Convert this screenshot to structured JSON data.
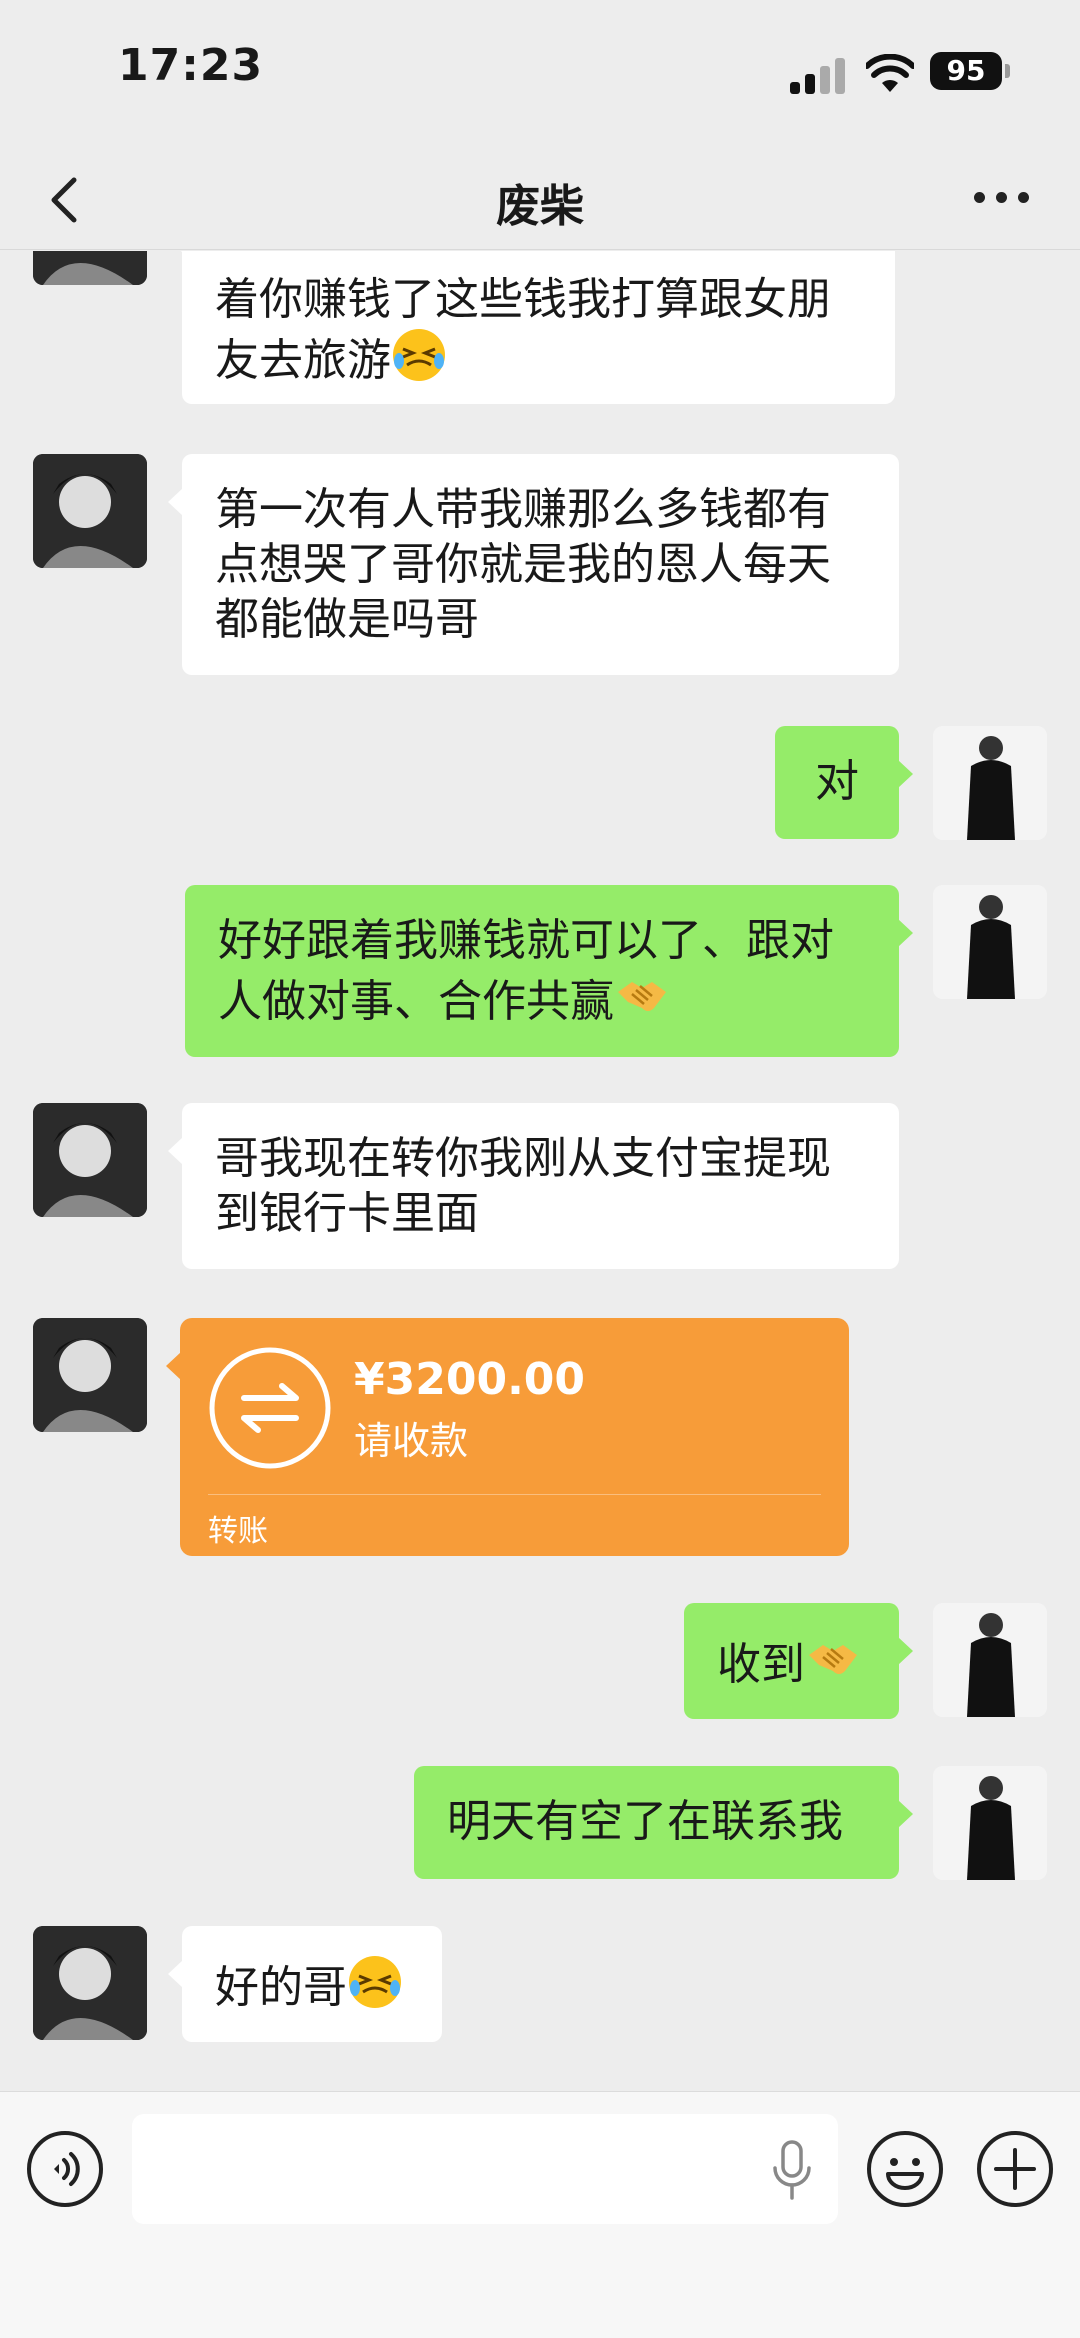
{
  "status_bar": {
    "time": "17:23",
    "battery": "95"
  },
  "nav": {
    "title": "废柴"
  },
  "messages": [
    {
      "from": "other",
      "text": "着你赚钱了这些钱我打算跟女朋友去旅游"
    },
    {
      "from": "other",
      "text": "第一次有人带我赚那么多钱都有点想哭了哥你就是我的恩人每天都能做是吗哥"
    },
    {
      "from": "me",
      "text": "对"
    },
    {
      "from": "me",
      "text": "好好跟着我赚钱就可以了、跟对人做对事、合作共赢"
    },
    {
      "from": "other",
      "text": "哥我现在转你我刚从支付宝提现到银行卡里面"
    },
    {
      "from": "me",
      "text": "收到"
    },
    {
      "from": "me",
      "text": "明天有空了在联系我"
    },
    {
      "from": "other",
      "text": "好的哥"
    }
  ],
  "transfer": {
    "amount": "¥3200.00",
    "note": "请收款",
    "label": "转账"
  },
  "emoji_names": {
    "crying_laugh": "tears-of-joy-emoji",
    "handshake": "handshake-emoji"
  },
  "colors": {
    "my_bubble": "#95ec69",
    "transfer": "#f79c39"
  }
}
